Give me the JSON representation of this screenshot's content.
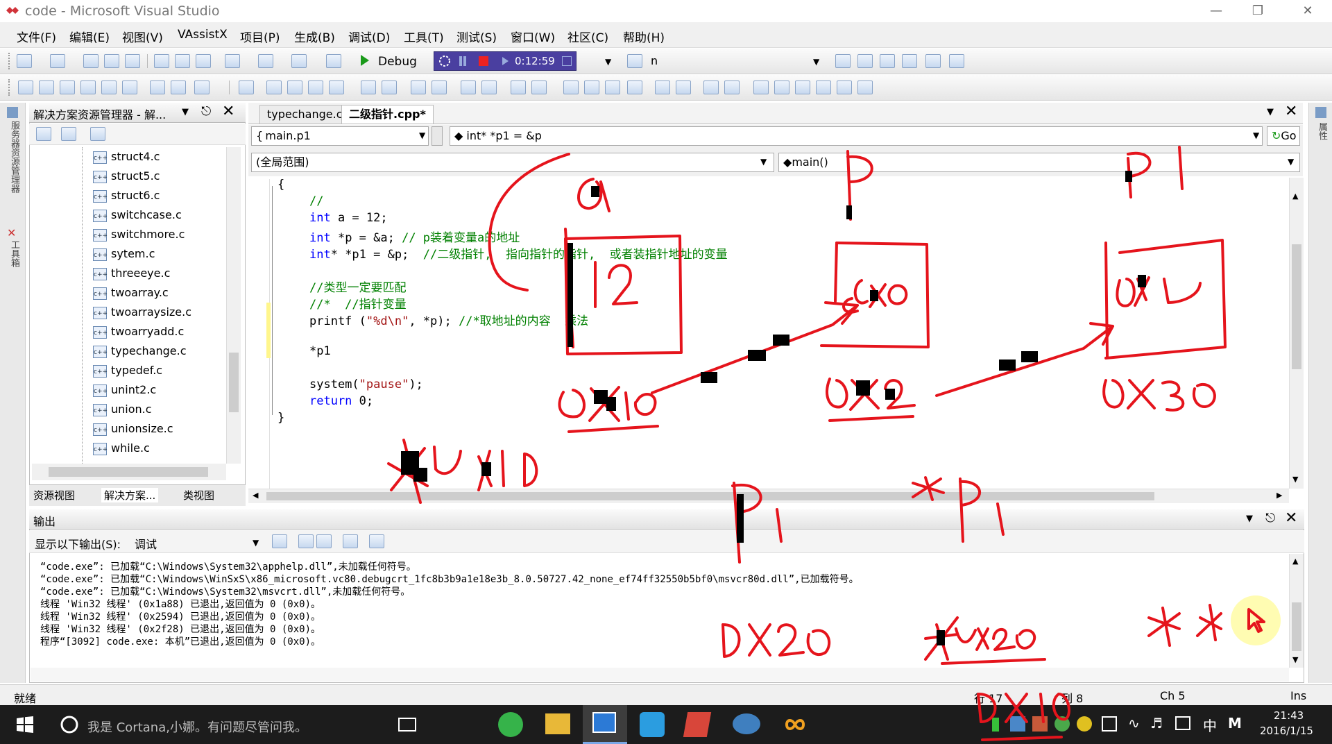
{
  "window": {
    "title": "code - Microsoft Visual Studio"
  },
  "menu": [
    "文件(F)",
    "编辑(E)",
    "视图(V)",
    "VAssistX",
    "项目(P)",
    "生成(B)",
    "调试(D)",
    "工具(T)",
    "测试(S)",
    "窗口(W)",
    "社区(C)",
    "帮助(H)"
  ],
  "toolbar": {
    "config": "Debug",
    "record_time": "0:12:59",
    "find_text": "n"
  },
  "solution_panel": {
    "title": "解决方案资源管理器 - 解...",
    "files": [
      "struct4.c",
      "struct5.c",
      "struct6.c",
      "switchcase.c",
      "switchmore.c",
      "sytem.c",
      "threeeye.c",
      "twoarray.c",
      "twoarraysize.c",
      "twoarryadd.c",
      "typechange.c",
      "typedef.c",
      "unint2.c",
      "union.c",
      "unionsize.c",
      "while.c"
    ],
    "file_icon": "c++",
    "tabs": [
      "资源视图",
      "解决方案...",
      "类视图"
    ]
  },
  "side_tabs": {
    "left_1": "服务器资源管理器",
    "left_2": "工具箱",
    "right_1": "属性"
  },
  "editor": {
    "tabs": [
      "typechange.c",
      "二级指针.cpp*"
    ],
    "nav_left": "main.p1",
    "nav_right": "int* *p1 = &p",
    "scope_left": "(全局范围)",
    "scope_right": "main()",
    "go_label": "Go",
    "lines": {
      "l0": "{",
      "l1": "//",
      "l2a": "int",
      "l2b": " a = 12;",
      "l3a": "int",
      "l3b": " *p = &a; ",
      "l3c": "// p装着变量a的地址",
      "l4a": "int",
      "l4b": "* *p1 = &p;  ",
      "l4c": "//二级指针,  指向指针的指针,  或者装指针地址的变量",
      "l5": "//类型一定要匹配",
      "l6": "//*  //指针变量",
      "l7a": "printf (",
      "l7b": "\"%d\\n\"",
      "l7c": ", *p); ",
      "l7d": "//*取地址的内容  乘法",
      "l8": "*p1",
      "l9a": "system(",
      "l9b": "\"pause\"",
      "l9c": ");",
      "l10a": "return",
      "l10b": " 0;",
      "l11": "}"
    }
  },
  "output": {
    "title": "输出",
    "show_label": "显示以下输出(S):",
    "show_value": "调试",
    "lines": [
      "“code.exe”: 已加载“C:\\Windows\\System32\\apphelp.dll”,未加载任何符号。",
      "“code.exe”: 已加载“C:\\Windows\\WinSxS\\x86_microsoft.vc80.debugcrt_1fc8b3b9a1e18e3b_8.0.50727.42_none_ef74ff32550b5bf0\\msvcr80d.dll”,已加载符号。",
      "“code.exe”: 已加载“C:\\Windows\\System32\\msvcrt.dll”,未加载任何符号。",
      "线程 'Win32 线程' (0x1a88) 已退出,返回值为 0 (0x0)。",
      "线程 'Win32 线程' (0x2594) 已退出,返回值为 0 (0x0)。",
      "线程 'Win32 线程' (0x2f28) 已退出,返回值为 0 (0x0)。",
      "程序“[3092] code.exe: 本机”已退出,返回值为 0 (0x0)。"
    ]
  },
  "status": {
    "ready": "就绪",
    "line": "行 17",
    "col": "列 8",
    "ch": "Ch 5",
    "ins": "Ins"
  },
  "taskbar": {
    "cortana": "我是 Cortana,小娜。有问题尽管问我。",
    "time": "21:43",
    "date": "2016/1/15",
    "ime": "中",
    "ime2": "M"
  },
  "colors": {
    "ink": "#e5141c",
    "keyword": "#0000ff",
    "comment": "#008000",
    "string": "#a31515",
    "record_bar": "#4a3fa0"
  }
}
